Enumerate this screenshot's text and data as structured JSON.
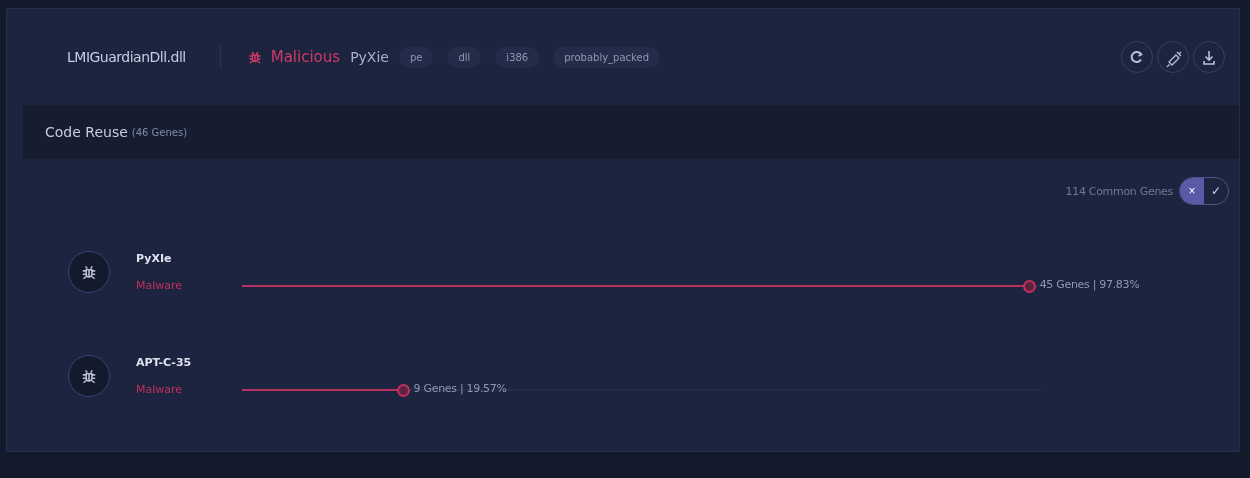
{
  "header": {
    "filename": "LMIGuardianDll.dll",
    "verdict": "Malicious",
    "family": "PyXie",
    "tags": [
      "pe",
      "dll",
      "i386",
      "probably_packed"
    ],
    "actions": [
      {
        "kind": "refresh"
      },
      {
        "kind": "inject"
      },
      {
        "kind": "download"
      }
    ]
  },
  "section": {
    "title": "Code Reuse",
    "count": "(46 Genes)"
  },
  "filter": {
    "label": "114 Common Genes",
    "options": [
      {
        "label": "×",
        "selected": true
      },
      {
        "label": "✓",
        "selected": false
      }
    ]
  },
  "matches": [
    {
      "name": "PyXIe",
      "type": "Malware",
      "level": 0.9783,
      "reading": "45 Genes | 97.83%"
    },
    {
      "name": "APT-C-35",
      "type": "Malware",
      "level": 0.1957,
      "reading": "9 Genes | 19.57%"
    }
  ]
}
